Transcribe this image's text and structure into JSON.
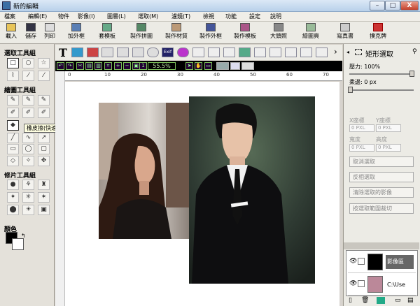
{
  "window": {
    "title": "新的編輯",
    "min_label": "–",
    "max_label": "□",
    "close_label": "X"
  },
  "menu": [
    "檔案",
    "編輯(E)",
    "物件",
    "影像(I)",
    "圖層(L)",
    "選取(M)",
    "濾鏡(T)",
    "檢視",
    "功能",
    "設定",
    "說明"
  ],
  "toolbar": [
    "載入",
    "儲存",
    "列印",
    "加外框",
    "套模板",
    "製作拼圖",
    "製作材質",
    "製作外框",
    "製作模板",
    "大頭照",
    "繪圖頁",
    "寫真書",
    "撲克牌"
  ],
  "left_panel": {
    "select_group": "選取工具組",
    "draw_group": "繪圖工具組",
    "retouch_group": "修片工具組",
    "color_label": "顏色",
    "tooltip": "橡皮擦(快速鍵：E)"
  },
  "icon_toolbar": {
    "text_tool": "T",
    "exif_label": "Exif",
    "more": "›"
  },
  "zoom": {
    "value": "55.5%"
  },
  "ruler": [
    "0",
    "10",
    "20",
    "30",
    "40",
    "50",
    "60",
    "70"
  ],
  "right_panel": {
    "title": "矩形選取",
    "pressure": "壓力: 100%",
    "feather": "柔邊: 0 px",
    "x_label": "X座標",
    "y_label": "Y座標",
    "width_label": "寬度",
    "height_label": "高度",
    "field_unit": "0 PXL",
    "buttons": [
      "取消選取",
      "反相選取",
      "清除選取的影像",
      "按選取範圍裁切"
    ]
  },
  "layers": [
    {
      "name": "影像區",
      "path": ""
    },
    {
      "name": "",
      "path": "C:\\Use"
    }
  ],
  "colors": {
    "foreground": "#000000",
    "background": "#ffffff",
    "accent": "#3a6ea5",
    "zoom_text": "#bfe7a7"
  }
}
